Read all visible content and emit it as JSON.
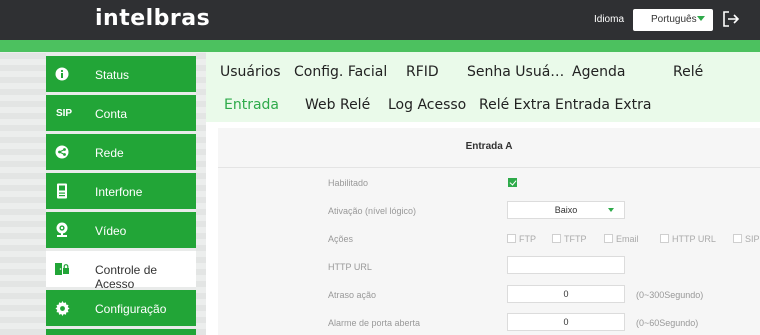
{
  "header": {
    "logo": "intelbras",
    "language_label": "Idioma",
    "language_value": "Português",
    "logout_icon": "logout-icon"
  },
  "sidebar": {
    "items": [
      {
        "label": "Status",
        "icon": "info-icon"
      },
      {
        "label": "Conta",
        "icon": "SIP"
      },
      {
        "label": "Rede",
        "icon": "network-icon"
      },
      {
        "label": "Interfone",
        "icon": "intercom-icon"
      },
      {
        "label": "Vídeo",
        "icon": "camera-icon"
      },
      {
        "label": "Controle de Acesso",
        "icon": "door-access-icon"
      },
      {
        "label": "Configuração",
        "icon": "gear-icon"
      }
    ],
    "active_index": 5
  },
  "tabs": {
    "row1": [
      "Usuários",
      "Config. Facial",
      "RFID",
      "Senha Usuá…",
      "Agenda",
      "Relé"
    ],
    "row2": [
      "Entrada",
      "Web Relé",
      "Log Acesso",
      "Relé Extra",
      "Entrada Extra"
    ],
    "active": "Entrada"
  },
  "form": {
    "section_title": "Entrada A",
    "enabled_label": "Habilitado",
    "enabled_checked": true,
    "activation_label": "Ativação (nível lógico)",
    "activation_value": "Baixo",
    "actions_label": "Ações",
    "actions": [
      "FTP",
      "TFTP",
      "Email",
      "HTTP URL",
      "SIP"
    ],
    "http_url_label": "HTTP URL",
    "http_url_value": "",
    "action_delay_label": "Atraso ação",
    "action_delay_value": "0",
    "action_delay_hint": "(0~300Segundo)",
    "door_alarm_label": "Alarme de porta aberta",
    "door_alarm_value": "0",
    "door_alarm_hint": "(0~60Segundo)"
  },
  "colors": {
    "accent": "#2eaa4a",
    "sidebar_green": "#22a537",
    "topbar": "#2f3033",
    "tab_bg": "#eafaea"
  }
}
